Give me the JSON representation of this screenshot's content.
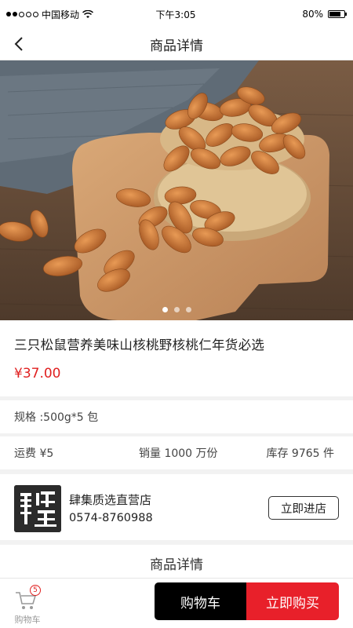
{
  "status_bar": {
    "carrier": "中国移动",
    "time": "下午3:05",
    "battery_text": "80%",
    "battery_level": 0.8,
    "signal_bars_filled": 2,
    "signal_bars_total": 5,
    "wifi_icon": "wifi-icon"
  },
  "nav": {
    "title": "商品详情",
    "back_icon": "chevron-left-icon"
  },
  "gallery": {
    "image_count": 3,
    "active_index": 0
  },
  "product": {
    "title": "三只松鼠营养美味山核桃野核桃仁年货必选",
    "price": "¥37.00"
  },
  "spec": {
    "text": "规格 :500g*5 包"
  },
  "stats": {
    "shipping": "运费 ¥5",
    "sales": "销量 1000 万份",
    "stock": "库存 9765 件"
  },
  "shop": {
    "name": "肆集质选直营店",
    "phone": "0574-8760988",
    "enter_label": "立即进店"
  },
  "detail_section": {
    "title": "商品详情"
  },
  "bottom_bar": {
    "cart_label": "购物车",
    "cart_badge": "5",
    "add_to_cart_label": "购物车",
    "buy_now_label": "立即购买"
  },
  "colors": {
    "price_red": "#e02020",
    "buy_red": "#e8202a",
    "cart_black": "#000000"
  }
}
